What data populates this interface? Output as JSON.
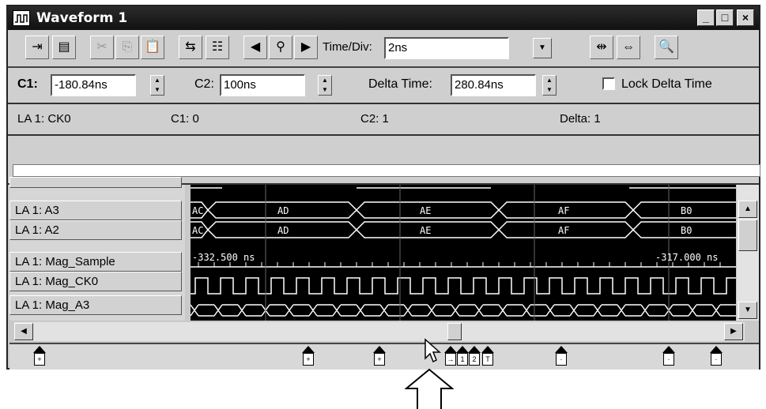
{
  "window": {
    "title": "Waveform 1",
    "min_label": "_",
    "max_label": "□",
    "close_label": "×"
  },
  "toolbar": {
    "timediv_label": "Time/Div:",
    "timediv_value": "2ns",
    "icons": [
      "insert-icon",
      "add-signal-icon",
      "cut-icon",
      "copy-icon",
      "paste-icon",
      "goto-icon",
      "properties-icon",
      "left-arrow-icon",
      "find-icon",
      "right-arrow-icon",
      "compress-icon",
      "expand-icon",
      "zoom-icon"
    ]
  },
  "cursors": {
    "c1_label": "C1:",
    "c1_value": "-180.84ns",
    "c2_label": "C2:",
    "c2_value": "100ns",
    "delta_label": "Delta Time:",
    "delta_value": "280.84ns",
    "lock_label": "Lock Delta Time"
  },
  "status": {
    "signal": "LA 1: CK0",
    "c1": "C1: 0",
    "c2": "C2: 1",
    "delta": "Delta: 1"
  },
  "signals": [
    {
      "name": "LA 1: A3"
    },
    {
      "name": "LA 1: A2"
    },
    {
      "name": "LA 1: Mag_Sample"
    },
    {
      "name": "LA 1: Mag_CK0"
    },
    {
      "name": "LA 1: Mag_A3"
    }
  ],
  "bus_values": {
    "a3": [
      "AC",
      "AD",
      "AE",
      "AF",
      "B0"
    ],
    "a2": [
      "AC",
      "AD",
      "AE",
      "AF",
      "B0"
    ]
  },
  "mag_sample": {
    "left_time": "-332.500 ns",
    "right_time": "-317.000 ns"
  },
  "markers": [
    "1",
    "2"
  ],
  "colors": {
    "waveform_bg": "#000000",
    "waveform_fg": "#ffffff",
    "titlebar": "#1a1a1a"
  }
}
